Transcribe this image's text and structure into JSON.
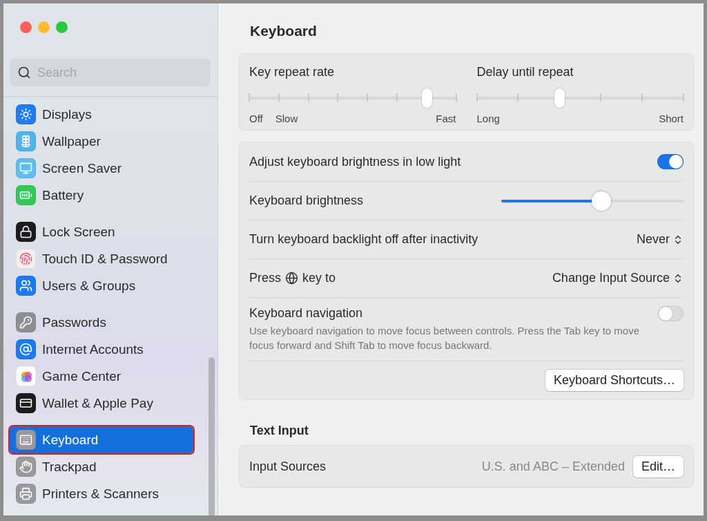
{
  "window": {
    "title": "Keyboard",
    "controls": [
      {
        "color": "#fe5f57"
      },
      {
        "color": "#febc2e"
      },
      {
        "color": "#28c840"
      }
    ]
  },
  "search": {
    "placeholder": "Search"
  },
  "sidebar": {
    "groups": [
      [
        {
          "label": "Displays",
          "selected": false,
          "color": "#1f7cf2"
        },
        {
          "label": "Wallpaper",
          "selected": false,
          "color": "#4fb3ec"
        },
        {
          "label": "Screen Saver",
          "selected": false,
          "color": "#5fbdf0"
        },
        {
          "label": "Battery",
          "selected": false,
          "color": "#34c759"
        }
      ],
      [
        {
          "label": "Lock Screen",
          "selected": false,
          "color": "#1c1c1e"
        },
        {
          "label": "Touch ID & Password",
          "selected": false,
          "color": "#f4f0f0"
        },
        {
          "label": "Users & Groups",
          "selected": false,
          "color": "#1a7cf4"
        }
      ],
      [
        {
          "label": "Passwords",
          "selected": false,
          "color": "#8e8e93"
        },
        {
          "label": "Internet Accounts",
          "selected": false,
          "color": "#1a7cf4"
        },
        {
          "label": "Game Center",
          "selected": false,
          "color": "#ffffff"
        },
        {
          "label": "Wallet & Apple Pay",
          "selected": false,
          "color": "#1c1c1e"
        }
      ],
      [
        {
          "label": "Keyboard",
          "selected": true,
          "color": "#9a9a9e"
        },
        {
          "label": "Trackpad",
          "selected": false,
          "color": "#9a9a9e"
        },
        {
          "label": "Printers & Scanners",
          "selected": false,
          "color": "#9a9a9e"
        }
      ]
    ]
  },
  "repeat": {
    "sliders": [
      {
        "title": "Key repeat rate",
        "level": 0.857,
        "labels": [
          "Off",
          "Slow",
          "Fast"
        ]
      },
      {
        "title": "Delay until repeat",
        "level": 0.4,
        "labels": [
          "Long",
          "Short"
        ]
      }
    ]
  },
  "settings": [
    {
      "kind": "toggle",
      "label": "Adjust keyboard brightness in low light",
      "on": true
    },
    {
      "kind": "slider",
      "label": "Keyboard brightness",
      "level": 0.55
    },
    {
      "kind": "select",
      "label": "Turn keyboard backlight off after inactivity",
      "value": "Never"
    },
    {
      "kind": "select",
      "label": "Press",
      "label_after": "key to",
      "value": "Change Input Source"
    },
    {
      "kind": "toggle",
      "label": "Keyboard navigation",
      "description": "Use keyboard navigation to move focus between controls. Press the Tab key to move focus forward and Shift Tab to move focus backward.",
      "on": false
    },
    {
      "kind": "button",
      "label": "Keyboard Shortcuts…"
    }
  ],
  "text_input": {
    "heading": "Text Input",
    "rows": [
      {
        "label": "Input Sources",
        "value": "U.S. and ABC – Extended",
        "button": "Edit…"
      }
    ]
  }
}
